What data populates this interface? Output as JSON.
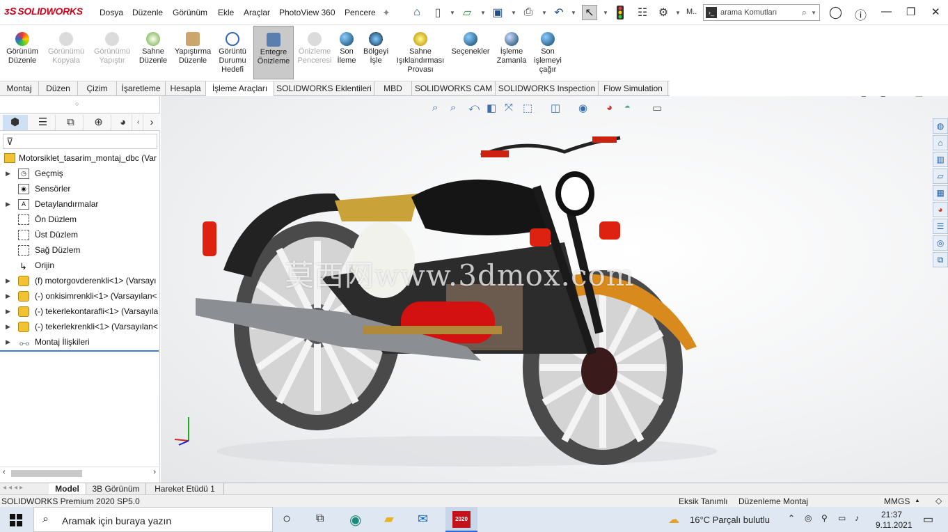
{
  "app": {
    "logo_brand": "SOLIDWORKS",
    "menu": [
      "Dosya",
      "Düzenle",
      "Görünüm",
      "Ekle",
      "Araçlar",
      "PhotoView 360",
      "Pencere"
    ],
    "search_placeholder": "arama Komutları",
    "more_label": "M.."
  },
  "command_manager": [
    {
      "label": "Görünüm Düzenle",
      "state": "enabled",
      "icon": "appearance-icon"
    },
    {
      "label": "Görünümü Kopyala",
      "state": "disabled",
      "icon": "copy-appearance-icon"
    },
    {
      "label": "Görünümü Yapıştır",
      "state": "disabled",
      "icon": "paste-appearance-icon"
    },
    {
      "label": "Sahne Düzenle",
      "state": "enabled",
      "icon": "scene-icon"
    },
    {
      "label": "Yapıştırma Düzenle",
      "state": "enabled",
      "icon": "decal-icon"
    },
    {
      "label": "Görüntü Durumu Hedefi",
      "state": "enabled",
      "icon": "target-icon"
    },
    {
      "label": "Entegre Önizleme",
      "state": "active",
      "icon": "preview-icon"
    },
    {
      "label": "Önizleme Penceresi",
      "state": "disabled",
      "icon": "preview-window-icon"
    },
    {
      "label": "Son İleme",
      "state": "enabled",
      "icon": "final-render-icon"
    },
    {
      "label": "Bölgeyi İşle",
      "state": "enabled",
      "icon": "render-region-icon"
    },
    {
      "label": "Sahne Işıklandırması Provası",
      "state": "enabled",
      "icon": "lighting-icon"
    },
    {
      "label": "Seçenekler",
      "state": "enabled",
      "icon": "options-icon"
    },
    {
      "label": "İşleme Zamanla",
      "state": "enabled",
      "icon": "schedule-icon"
    },
    {
      "label": "Son işlemeyi çağır",
      "state": "enabled",
      "icon": "recall-icon"
    }
  ],
  "tabs": [
    "Montaj",
    "Düzen",
    "Çizim",
    "İşaretleme",
    "Hesapla",
    "İşleme Araçları",
    "SOLIDWORKS Eklentileri",
    "MBD",
    "SOLIDWORKS CAM",
    "SOLIDWORKS Inspection",
    "Flow Simulation"
  ],
  "active_tab": "İşleme Araçları",
  "feature_tree": {
    "root": "Motorsiklet_tasarim_montaj_dbc  (Var",
    "items": [
      {
        "label": "Geçmiş",
        "expandable": true,
        "icon": "history-icon"
      },
      {
        "label": "Sensörler",
        "expandable": false,
        "icon": "sensor-icon"
      },
      {
        "label": "Detaylandırmalar",
        "expandable": true,
        "icon": "annotation-icon"
      },
      {
        "label": "Ön Düzlem",
        "expandable": false,
        "icon": "plane-icon"
      },
      {
        "label": "Üst Düzlem",
        "expandable": false,
        "icon": "plane-icon"
      },
      {
        "label": "Sağ Düzlem",
        "expandable": false,
        "icon": "plane-icon"
      },
      {
        "label": "Orijin",
        "expandable": false,
        "icon": "origin-icon"
      },
      {
        "label": "(f) motorgovderenkli<1> (Varsayı",
        "expandable": true,
        "icon": "part-icon"
      },
      {
        "label": "(-) onkisimrenkli<1> (Varsayılan<",
        "expandable": true,
        "icon": "part-icon"
      },
      {
        "label": "(-) tekerlekontarafli<1> (Varsayıla",
        "expandable": true,
        "icon": "part-icon"
      },
      {
        "label": "(-) tekerlekrenkli<1> (Varsayılan<",
        "expandable": true,
        "icon": "part-icon"
      },
      {
        "label": "Montaj İlişkileri",
        "expandable": true,
        "icon": "mates-icon"
      }
    ]
  },
  "viewport": {
    "watermark": "莫西网www.3dmox.com"
  },
  "bottom_tabs": [
    "Model",
    "3B Görünüm",
    "Hareket Etüdü 1"
  ],
  "active_bottom_tab": "Model",
  "status": {
    "version": "SOLIDWORKS Premium 2020 SP5.0",
    "definition": "Eksik Tanımlı",
    "mode": "Düzenleme Montaj",
    "units": "MMGS"
  },
  "taskbar": {
    "search_placeholder": "Aramak için buraya yazın",
    "weather": "16°C  Parçalı bulutlu",
    "time": "21:37",
    "date": "9.11.2021",
    "sw_badge": "2020"
  }
}
